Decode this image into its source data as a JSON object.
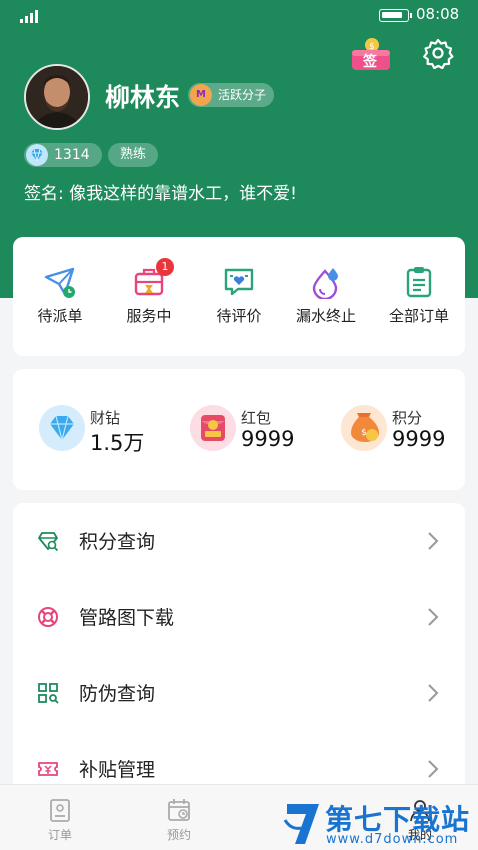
{
  "status_bar": {
    "time": "08:08"
  },
  "header": {
    "sign_in_label": "签",
    "username": "柳林东",
    "member_tag": "活跃分子",
    "member_icon_text": "M",
    "diamond_count": "1314",
    "level": "熟练",
    "signature": "签名: 像我这样的靠谱水工，谁不爱!"
  },
  "orders": [
    {
      "label": "待派单",
      "icon": "send-clock-icon"
    },
    {
      "label": "服务中",
      "icon": "toolbox-icon",
      "badge": "1"
    },
    {
      "label": "待评价",
      "icon": "chat-heart-icon"
    },
    {
      "label": "漏水终止",
      "icon": "water-drop-icon"
    },
    {
      "label": "全部订单",
      "icon": "clipboard-icon"
    }
  ],
  "assets": [
    {
      "title": "财钻",
      "value": "1.5万",
      "icon": "diamond-icon"
    },
    {
      "title": "红包",
      "value": "9999",
      "icon": "red-packet-icon"
    },
    {
      "title": "积分",
      "value": "9999",
      "icon": "money-bag-icon"
    }
  ],
  "menu": [
    {
      "label": "积分查询",
      "icon": "diamond-search-icon"
    },
    {
      "label": "管路图下载",
      "icon": "lifebuoy-icon"
    },
    {
      "label": "防伪查询",
      "icon": "qr-scan-icon"
    },
    {
      "label": "补贴管理",
      "icon": "ticket-icon"
    }
  ],
  "tabbar": [
    {
      "label": "订单",
      "icon": "order-doc-icon"
    },
    {
      "label": "预约",
      "icon": "calendar-clock-icon"
    },
    {
      "label": "我的",
      "icon": "user-icon"
    }
  ],
  "watermark": {
    "title": "第七下载站",
    "url": "www.d7down.com"
  },
  "colors": {
    "brand_green": "#1e8a5c",
    "badge_red": "#e8363a",
    "watermark_blue": "#1874d0"
  }
}
